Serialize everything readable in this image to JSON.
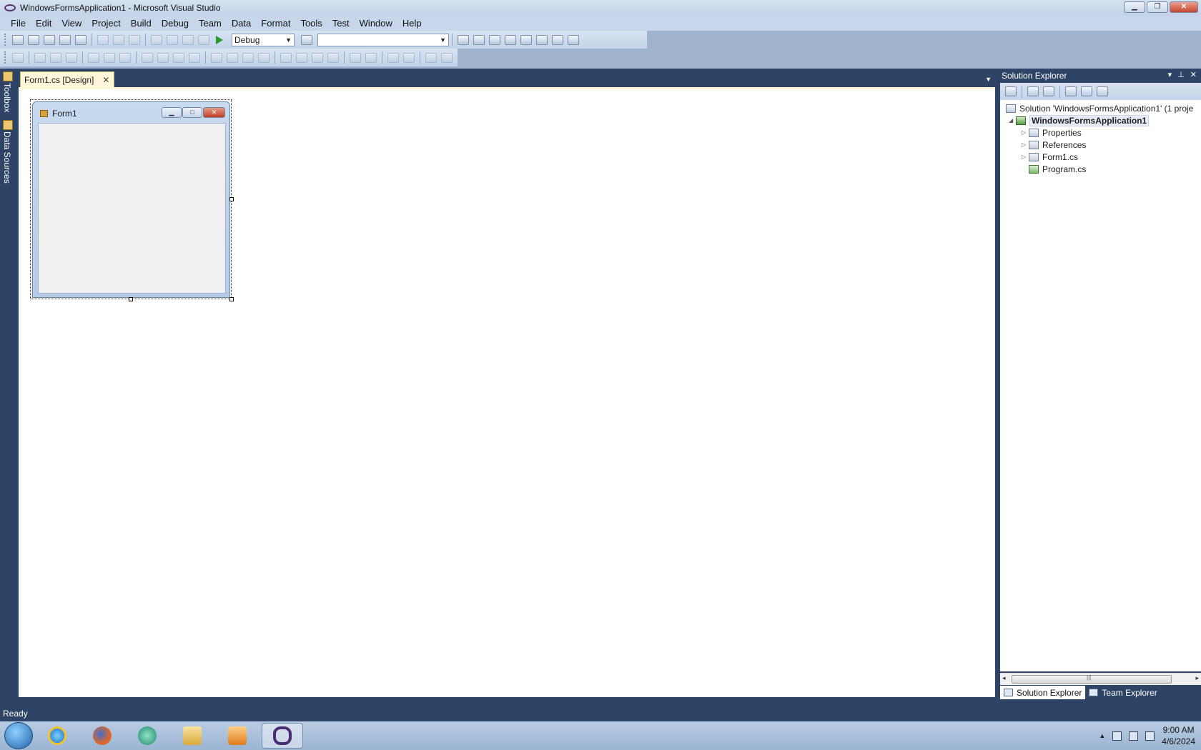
{
  "window": {
    "title": "WindowsFormsApplication1 - Microsoft Visual Studio",
    "minimize": "▁",
    "maximize": "❐",
    "close": "✕"
  },
  "menu": [
    "File",
    "Edit",
    "View",
    "Project",
    "Build",
    "Debug",
    "Team",
    "Data",
    "Format",
    "Tools",
    "Test",
    "Window",
    "Help"
  ],
  "toolbar": {
    "config": "Debug",
    "platform": "",
    "combo_arrow": "▼"
  },
  "sidebar": {
    "toolbox": "Toolbox",
    "data_sources": "Data Sources"
  },
  "document": {
    "tab_label": "Form1.cs [Design]",
    "tab_close": "✕",
    "dropdown": "▼"
  },
  "form_preview": {
    "title": "Form1",
    "minimize": "▁",
    "maximize": "□",
    "close": "✕"
  },
  "solution_explorer": {
    "title": "Solution Explorer",
    "head_buttons": [
      "▾",
      "⊥",
      "✕"
    ],
    "tree": [
      {
        "label": "Solution 'WindowsFormsApplication1' (1 proje",
        "arrow": ""
      },
      {
        "label": "WindowsFormsApplication1",
        "arrow": "◢"
      },
      {
        "label": "Properties",
        "arrow": "▷"
      },
      {
        "label": "References",
        "arrow": "▷"
      },
      {
        "label": "Form1.cs",
        "arrow": "▷"
      },
      {
        "label": "Program.cs",
        "arrow": ""
      }
    ],
    "scroll_left": "◂",
    "scroll_right": "▸",
    "scroll_grip": "|||",
    "tabs": [
      "Solution Explorer",
      "Team Explorer"
    ]
  },
  "status": {
    "text": "Ready"
  },
  "taskbar": {
    "clock_time": "9:00 AM",
    "clock_date": "4/6/2024",
    "apps": [
      "internet-explorer",
      "firefox",
      "chat-app",
      "file-explorer",
      "media-player",
      "visual-studio"
    ],
    "tray_arrow": "▲"
  }
}
